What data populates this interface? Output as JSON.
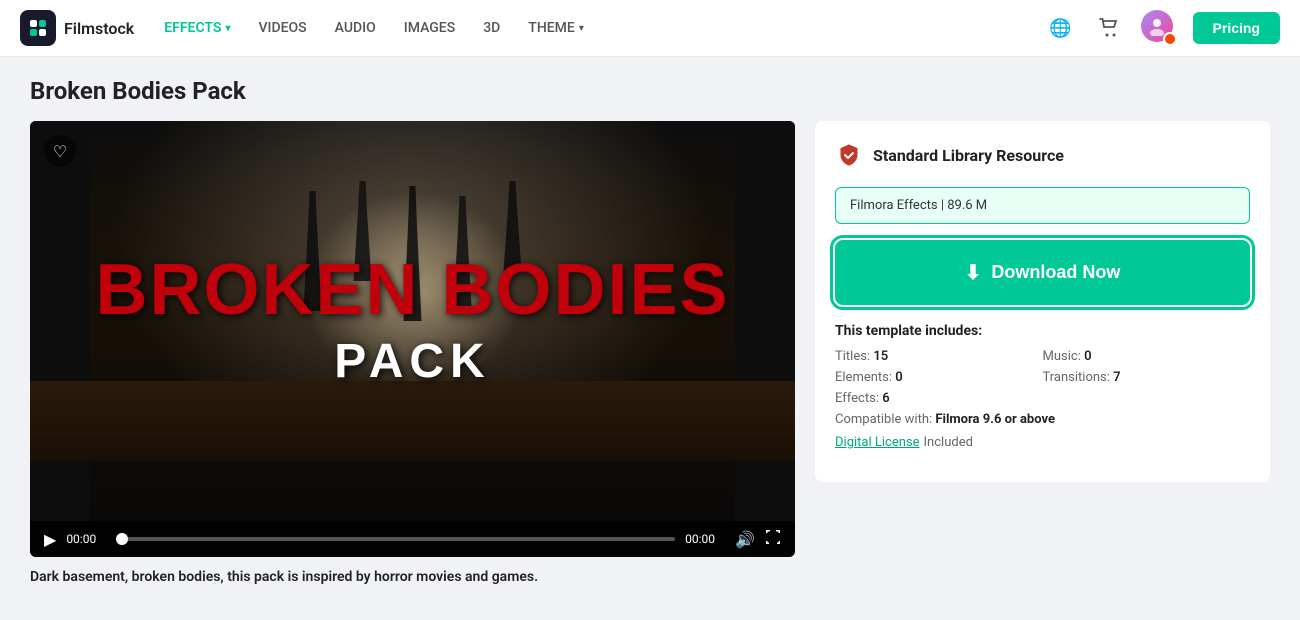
{
  "header": {
    "logo_text": "Filmstock",
    "nav_items": [
      {
        "label": "EFFECTS",
        "active": true,
        "has_chevron": true
      },
      {
        "label": "VIDEOS",
        "active": false,
        "has_chevron": false
      },
      {
        "label": "AUDIO",
        "active": false,
        "has_chevron": false
      },
      {
        "label": "IMAGES",
        "active": false,
        "has_chevron": false
      },
      {
        "label": "3D",
        "active": false,
        "has_chevron": false
      },
      {
        "label": "THEME",
        "active": false,
        "has_chevron": true
      }
    ],
    "pricing_label": "Pricing"
  },
  "page": {
    "title": "Broken Bodies Pack"
  },
  "video": {
    "title_line1": "BROKEN BODIES",
    "title_line2": "PACK",
    "time_start": "00:00",
    "time_end": "00:00"
  },
  "description": {
    "text": "Dark basement, broken bodies, this pack is inspired by horror movies and games."
  },
  "right_panel": {
    "resource_type": "Standard Library Resource",
    "filmora_badge": "Filmora Effects | 89.6 M",
    "download_label": "Download Now",
    "template_includes_title": "This template includes:",
    "stats": [
      {
        "label": "Titles:",
        "value": "15"
      },
      {
        "label": "Music:",
        "value": "0"
      },
      {
        "label": "Elements:",
        "value": "0"
      },
      {
        "label": "Transitions:",
        "value": "7"
      },
      {
        "label": "Effects:",
        "value": "6"
      }
    ],
    "compatible_label": "Compatible with:",
    "compatible_value": "Filmora 9.6 or above",
    "license_link_text": "Digital License",
    "license_suffix": "Included"
  },
  "icons": {
    "globe": "🌐",
    "cart": "🛒",
    "play": "▶",
    "volume": "🔊",
    "fullscreen": "⛶",
    "download": "⬇",
    "heart": "♡"
  }
}
